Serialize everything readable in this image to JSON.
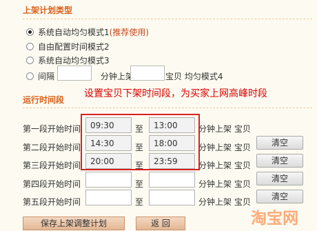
{
  "plan_type": {
    "title": "上架计划类型",
    "options": [
      {
        "label": "系统自动均匀模式1",
        "note": "(推荐使用)",
        "checked": true
      },
      {
        "label": "自由配置时间模式2",
        "checked": false
      },
      {
        "label": "系统自动均匀模式3",
        "checked": false
      }
    ],
    "mode4": {
      "label_prefix": "间隔",
      "label_mid": "分钟上架",
      "label_suffix": "宝贝  均匀模式4",
      "interval_value": "",
      "count_value": ""
    }
  },
  "annotation": "设置宝贝下架时间段，为买家上网高峰时段",
  "schedule": {
    "title": "运行时间段",
    "to_label": "至",
    "tail_label": "分钟上架  宝贝",
    "clear_label": "清空",
    "rows": [
      {
        "label": "第一段开始时间",
        "start": "09:30",
        "end": "13:00"
      },
      {
        "label": "第二段开始时间",
        "start": "14:30",
        "end": "18:00"
      },
      {
        "label": "第三段开始时间",
        "start": "20:00",
        "end": "23:59"
      },
      {
        "label": "第四段开始时间",
        "start": "",
        "end": ""
      },
      {
        "label": "第五段开始时间",
        "start": "",
        "end": ""
      }
    ]
  },
  "actions": {
    "save_label": "保存上架调整计划",
    "back_label": "返  回"
  },
  "watermark_text": "淘宝网",
  "colors": {
    "section_title": "#d8601a",
    "annotation": "#d80000",
    "highlight_frame": "#d82020",
    "background": "#fdfbf1"
  }
}
